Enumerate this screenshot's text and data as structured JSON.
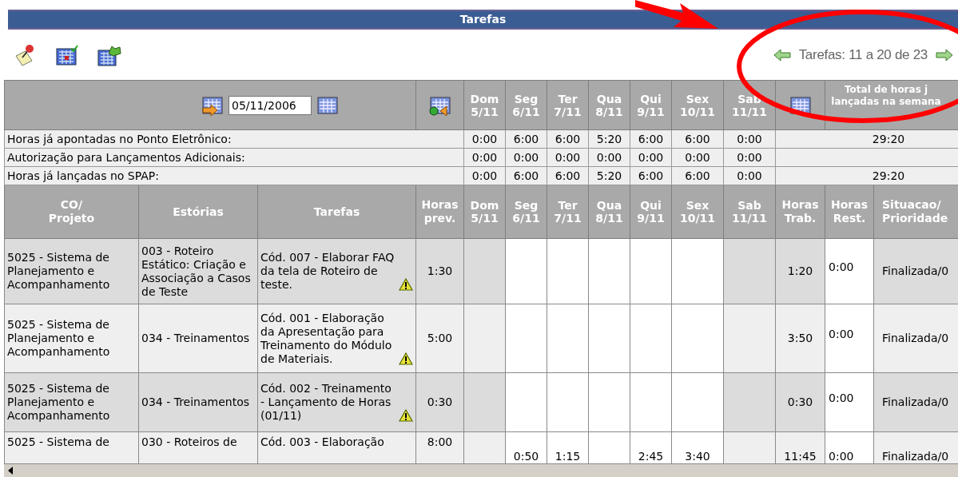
{
  "window": {
    "title": "Tarefas"
  },
  "pagination": {
    "label": "Tarefas: 11 a 20 de 23"
  },
  "date_field": {
    "value": "05/11/2006"
  },
  "days": [
    {
      "name": "Dom",
      "date": "5/11",
      "weekend": true
    },
    {
      "name": "Seg",
      "date": "6/11",
      "weekend": false
    },
    {
      "name": "Ter",
      "date": "7/11",
      "weekend": false
    },
    {
      "name": "Qua",
      "date": "8/11",
      "weekend": false
    },
    {
      "name": "Qui",
      "date": "9/11",
      "weekend": false
    },
    {
      "name": "Sex",
      "date": "10/11",
      "weekend": false
    },
    {
      "name": "Sab",
      "date": "11/11",
      "weekend": true
    }
  ],
  "total_header": "Total de horas j lançadas na semana",
  "summary_rows": [
    {
      "label": "Horas já apontadas no Ponto Eletrônico:",
      "values": [
        "0:00",
        "6:00",
        "6:00",
        "5:20",
        "6:00",
        "6:00",
        "0:00"
      ],
      "total": "29:20"
    },
    {
      "label": "Autorização para Lançamentos Adicionais:",
      "values": [
        "0:00",
        "0:00",
        "0:00",
        "0:00",
        "0:00",
        "0:00",
        "0:00"
      ]
    },
    {
      "label": "Horas já lançadas no SPAP:",
      "values": [
        "0:00",
        "6:00",
        "6:00",
        "5:20",
        "6:00",
        "6:00",
        "0:00"
      ],
      "total": "29:20"
    }
  ],
  "columns": {
    "project": "CO/ Projeto",
    "story": "Estórias",
    "task": "Tarefas",
    "planned": "Horas prev.",
    "days": [
      {
        "name": "Dom",
        "date": "5/11"
      },
      {
        "name": "Seg",
        "date": "6/11"
      },
      {
        "name": "Ter",
        "date": "7/11"
      },
      {
        "name": "Qua",
        "date": "8/11"
      },
      {
        "name": "Qui",
        "date": "9/11"
      },
      {
        "name": "Sex",
        "date": "10/11"
      },
      {
        "name": "Sab",
        "date": "11/11"
      }
    ],
    "worked": "Horas Trab.",
    "remaining": "Horas Rest.",
    "status": "Situacao/ Prioridade"
  },
  "rows": [
    {
      "project": "5025 - Sistema de Planejamento e Acompanhamento",
      "story": "003 - Roteiro Estático: Criação e Associação a Casos de Teste",
      "task": "Cód. 007 - Elaborar FAQ da tela de Roteiro de teste.",
      "warning": true,
      "planned": "1:30",
      "worked": "1:20",
      "remaining": "0:00",
      "status": "Finalizada/0"
    },
    {
      "project": "5025 - Sistema de Planejamento e Acompanhamento",
      "story": "034 - Treinamentos",
      "task": "Cód. 001 - Elaboração da Apresentação para Treinamento do Módulo de Materiais.",
      "warning": true,
      "planned": "5:00",
      "worked": "3:50",
      "remaining": "0:00",
      "status": "Finalizada/0"
    },
    {
      "project": "5025 - Sistema de Planejamento e Acompanhamento",
      "story": "034 - Treinamentos",
      "task": "Cód. 002 - Treinamento - Lançamento de Horas (01/11)",
      "warning": true,
      "planned": "0:30",
      "worked": "0:30",
      "remaining": "0:00",
      "status": "Finalizada/0"
    },
    {
      "project": "5025 - Sistema de",
      "story": "030 - Roteiros de",
      "task": "Cód. 003 - Elaboração",
      "warning": false,
      "planned": "8:00",
      "day_hours": {
        "day_1": "0:50",
        "day_2": "1:15",
        "day_4": "2:45",
        "day_5": "3:40"
      },
      "worked": "11:45",
      "remaining": "0:00",
      "status": "Finalizada/0"
    }
  ]
}
